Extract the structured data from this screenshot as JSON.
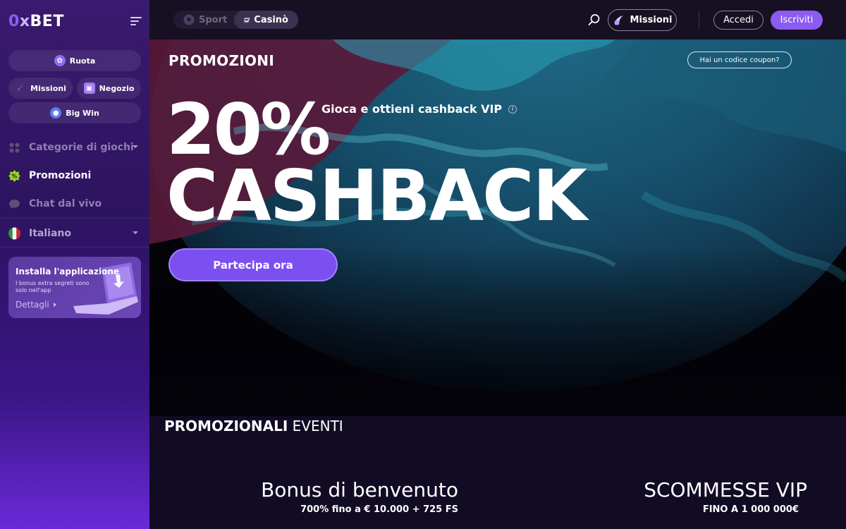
{
  "logo": {
    "zero": "0",
    "x": "x",
    "rest": "BET"
  },
  "sidebar": {
    "pills": {
      "ruota": "Ruota",
      "missioni": "Missioni",
      "negozio": "Negozio",
      "big_win": "Big Win"
    },
    "nav": {
      "categorie": "Categorie di giochi",
      "promozioni": "Promozioni",
      "chat": "Chat dal vivo",
      "lingua": "Italiano"
    },
    "install": {
      "title": "Installa l'applicazione",
      "sub": "I bonus extra segreti sono solo nell'app",
      "details": "Dettagli"
    }
  },
  "header": {
    "tab_sport": "Sport",
    "tab_casino": "Casinò",
    "missioni": "Missioni",
    "accedi": "Accedi",
    "iscriviti": "Iscriviti"
  },
  "hero": {
    "title": "PROMOZIONI",
    "coupon": "Hai un codice coupon?",
    "percent": "20%",
    "word": "CASHBACK",
    "tagline": "Gioca e ottieni cashback VIP",
    "cta": "Partecipa ora"
  },
  "events": {
    "title_bold": "PROMOZIONALI",
    "title_light": " EVENTI",
    "cards": [
      {
        "title": "Bonus di benvenuto",
        "sub": "700% fino a € 10.000 + 725 FS"
      },
      {
        "title": "SCOMMESSE VIP",
        "sub": "FINO A 1 000 000€"
      }
    ]
  },
  "colors": {
    "accent": "#8a5cf0",
    "sidebar_bg": "#2d1460",
    "header_bg": "#171022"
  }
}
